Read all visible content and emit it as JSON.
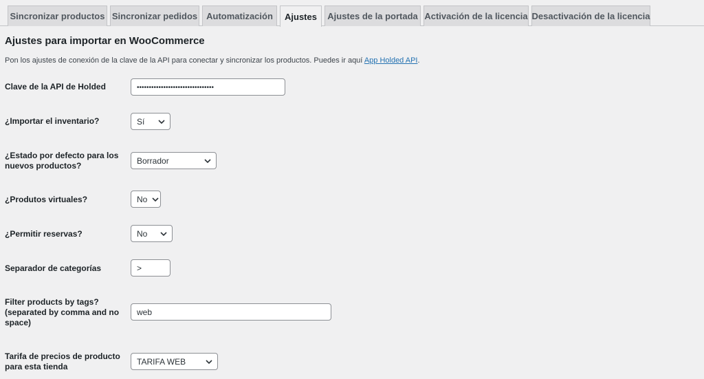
{
  "tabs": [
    {
      "label": "Sincronizar productos"
    },
    {
      "label": "Sincronizar pedidos"
    },
    {
      "label": "Automatización"
    },
    {
      "label": "Ajustes"
    },
    {
      "label": "Ajustes de la portada"
    },
    {
      "label": "Activación de la licencia"
    },
    {
      "label": "Desactivación de la licencia"
    }
  ],
  "active_tab": "Ajustes",
  "section": {
    "title": "Ajustes para importar en WooCommerce",
    "description": "Pon los ajustes de conexión de la clave de la API para conectar y sincronizar los productos. Puedes ir aquí ",
    "link_text": "App Holded API",
    "description_end": "."
  },
  "fields": {
    "api_key": {
      "label": "Clave de la API de Holded",
      "value": "••••••••••••••••••••••••••••••••"
    },
    "import_stock": {
      "label": "¿Importar el inventario?",
      "value": "Sí"
    },
    "default_status": {
      "label": "¿Estado por defecto para los nuevos productos?",
      "value": "Borrador"
    },
    "virtual": {
      "label": "¿Produtos virtuales?",
      "value": "No"
    },
    "backorders": {
      "label": "¿Permitir reservas?",
      "value": "No"
    },
    "cat_separator": {
      "label": "Separador de categorías",
      "value": ">"
    },
    "filter_tags": {
      "label": "Filter products by tags? (separated by comma and no space)",
      "value": "web"
    },
    "price_rate": {
      "label": "Tarifa de precios de producto para esta tienda",
      "value": "TARIFA WEB"
    }
  },
  "colors": {
    "link": "#2271b1",
    "background": "#f0f0f1",
    "tab_inactive": "#dcdcde"
  },
  "icons": {
    "select_arrow": "chevron-down-icon"
  }
}
